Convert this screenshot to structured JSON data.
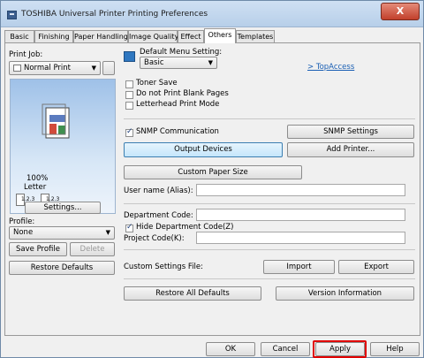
{
  "window": {
    "title": "TOSHIBA Universal Printer Printing Preferences",
    "close_label": "X"
  },
  "tabs": [
    "Basic",
    "Finishing",
    "Paper Handling",
    "Image Quality",
    "Effect",
    "Others",
    "Templates"
  ],
  "left_panel": {
    "print_job_label": "Print Job:",
    "print_job_value": "Normal Print",
    "preview_zoom": "100%",
    "preview_paper": "Letter",
    "preview_page_labels": [
      "1.2.3",
      "1.2.3"
    ],
    "settings_button": "Settings...",
    "profile_label": "Profile:",
    "profile_value": "None",
    "save_profile_button": "Save Profile",
    "delete_button": "Delete",
    "restore_defaults_button": "Restore Defaults"
  },
  "main": {
    "default_menu_label": "Default Menu Setting:",
    "default_menu_value": "Basic",
    "top_access_link": "> TopAccess",
    "toner_save_label": "Toner Save",
    "no_blank_pages_label": "Do not Print Blank Pages",
    "letterhead_label": "Letterhead Print Mode",
    "snmp_label": "SNMP Communication",
    "snmp_settings_button": "SNMP Settings",
    "output_devices_button": "Output Devices",
    "add_printer_button": "Add Printer...",
    "custom_paper_size_button": "Custom Paper Size",
    "user_name_label": "User name (Alias):",
    "user_name_value": "",
    "department_code_label": "Department Code:",
    "department_code_value": "",
    "hide_department_label": "Hide Department Code(Z)",
    "project_code_label": "Project Code(K):",
    "project_code_value": "",
    "custom_settings_label": "Custom Settings File:",
    "import_button": "Import",
    "export_button": "Export",
    "restore_all_button": "Restore All Defaults",
    "version_info_button": "Version Information"
  },
  "footer": {
    "ok": "OK",
    "cancel": "Cancel",
    "apply": "Apply",
    "help": "Help"
  }
}
